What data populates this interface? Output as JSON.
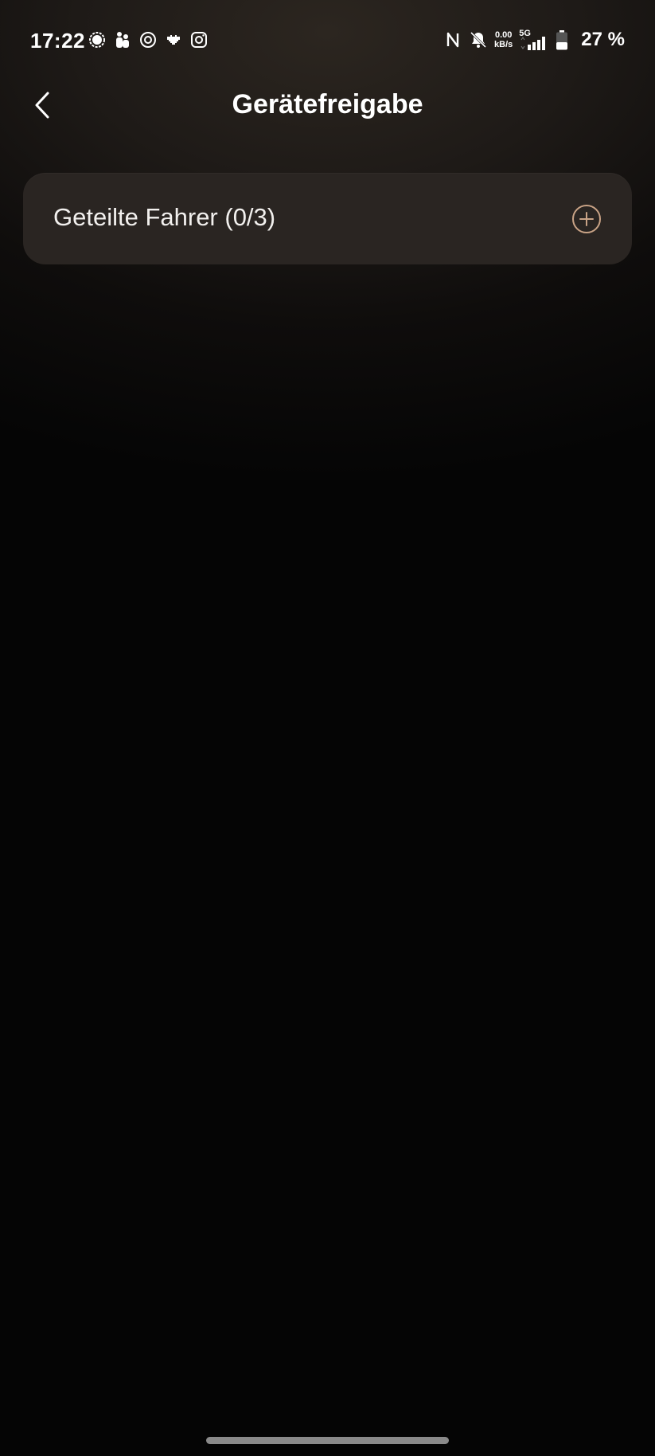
{
  "status_bar": {
    "time": "17:22",
    "left_icons": [
      "signal-messenger-icon",
      "family-icon",
      "lion-icon",
      "heart-pixel-icon",
      "instagram-icon"
    ],
    "nfc_icon": "nfc-icon",
    "mute_icon": "bell-off-icon",
    "speed_value": "0.00",
    "speed_unit": "kB/s",
    "network_type": "5G",
    "signal_icon": "signal-bars-icon",
    "battery_icon": "battery-icon",
    "battery_percent": "27 %"
  },
  "header": {
    "back_icon": "chevron-left-icon",
    "title": "Gerätefreigabe"
  },
  "shared_drivers": {
    "label": "Geteilte Fahrer (0/3)",
    "add_icon": "plus-circle-icon"
  },
  "colors": {
    "background": "#050505",
    "card": "#2a2522",
    "accent": "#c9a386",
    "text": "#ffffff"
  }
}
